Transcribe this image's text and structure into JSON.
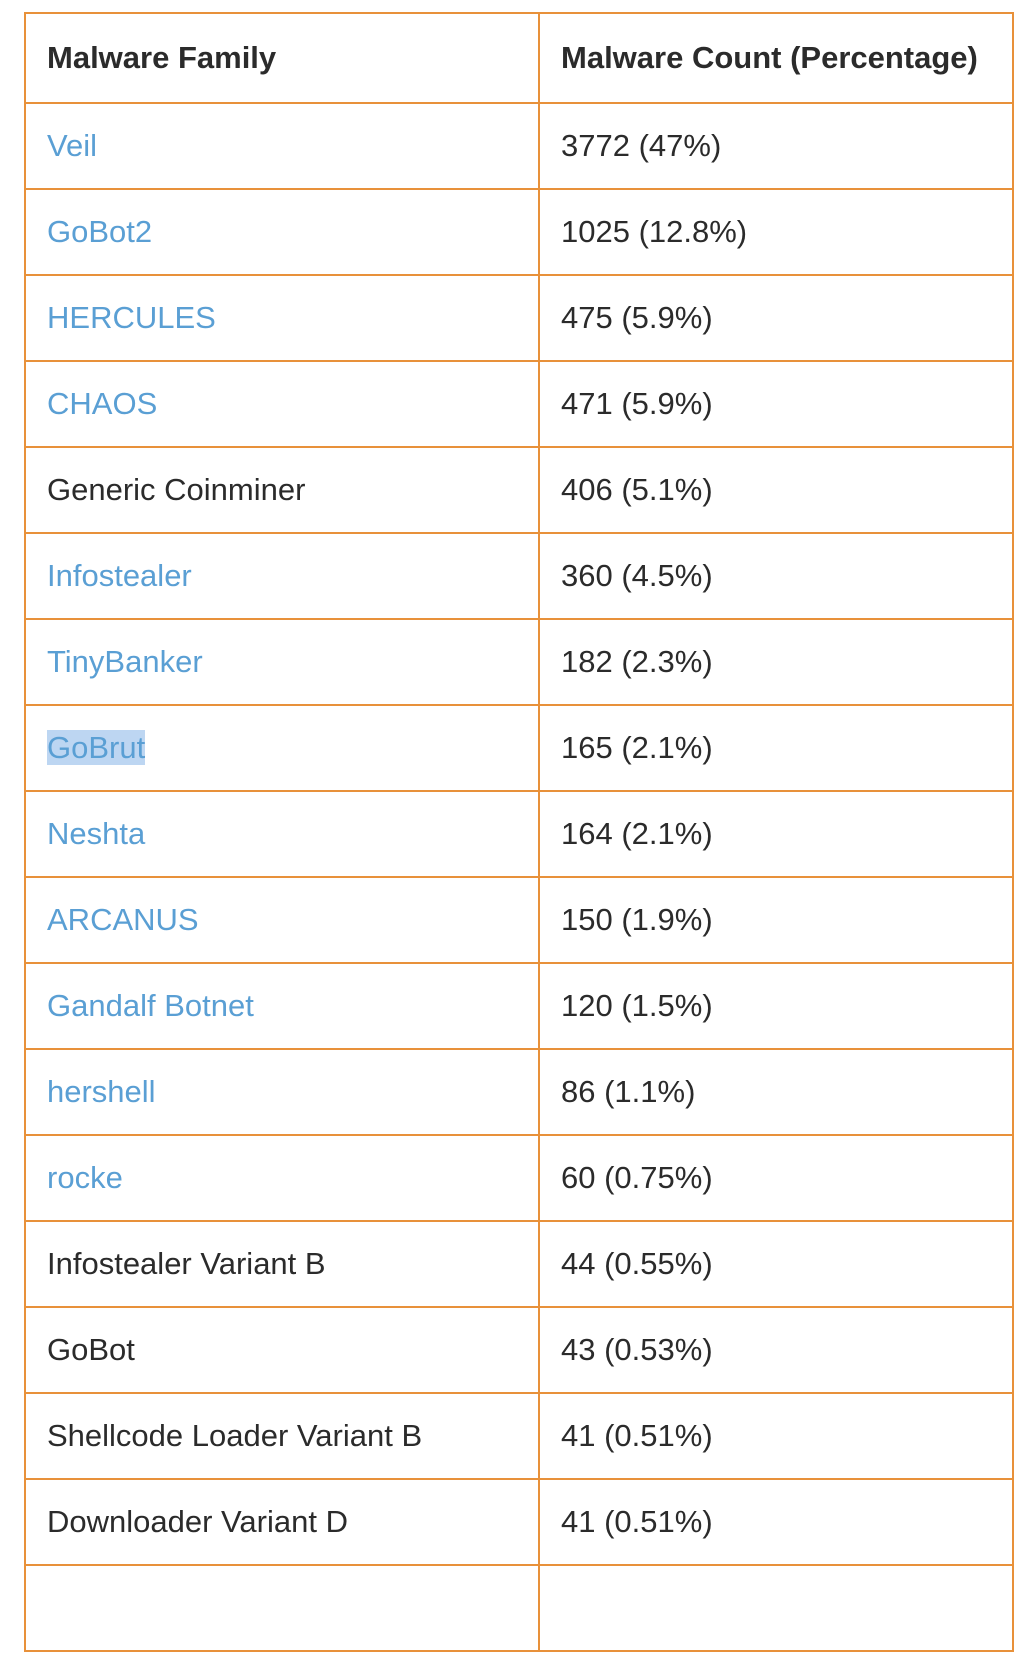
{
  "table": {
    "headers": [
      "Malware Family",
      "Malware Count (Percentage)"
    ],
    "rows": [
      {
        "family": "Veil",
        "count": "3772 (47%)",
        "link": true
      },
      {
        "family": "GoBot2",
        "count": "1025 (12.8%)",
        "link": true
      },
      {
        "family": "HERCULES",
        "count": "475 (5.9%)",
        "link": true
      },
      {
        "family": "CHAOS",
        "count": "471 (5.9%)",
        "link": true
      },
      {
        "family": "Generic Coinminer",
        "count": "406 (5.1%)",
        "link": false
      },
      {
        "family": "Infostealer",
        "count": "360 (4.5%)",
        "link": true
      },
      {
        "family": "TinyBanker",
        "count": "182 (2.3%)",
        "link": true
      },
      {
        "family": "GoBrut",
        "count": "165 (2.1%)",
        "link": true,
        "selected": true
      },
      {
        "family": "Neshta",
        "count": "164 (2.1%)",
        "link": true
      },
      {
        "family": "ARCANUS",
        "count": "150 (1.9%)",
        "link": true
      },
      {
        "family": "Gandalf Botnet",
        "count": "120 (1.5%)",
        "link": true
      },
      {
        "family": "hershell",
        "count": "86 (1.1%)",
        "link": true
      },
      {
        "family": "rocke",
        "count": "60 (0.75%)",
        "link": true
      },
      {
        "family": "Infostealer Variant B",
        "count": "44 (0.55%)",
        "link": false
      },
      {
        "family": "GoBot",
        "count": "43 (0.53%)",
        "link": false
      },
      {
        "family": "Shellcode Loader Variant B",
        "count": "41 (0.51%)",
        "link": false
      },
      {
        "family": "Downloader Variant D",
        "count": "41 (0.51%)",
        "link": false
      }
    ]
  },
  "colors": {
    "border": "#e8913a",
    "link": "#5a9fd4",
    "text": "#2b2b2b",
    "selection": "#bdd6f2"
  }
}
